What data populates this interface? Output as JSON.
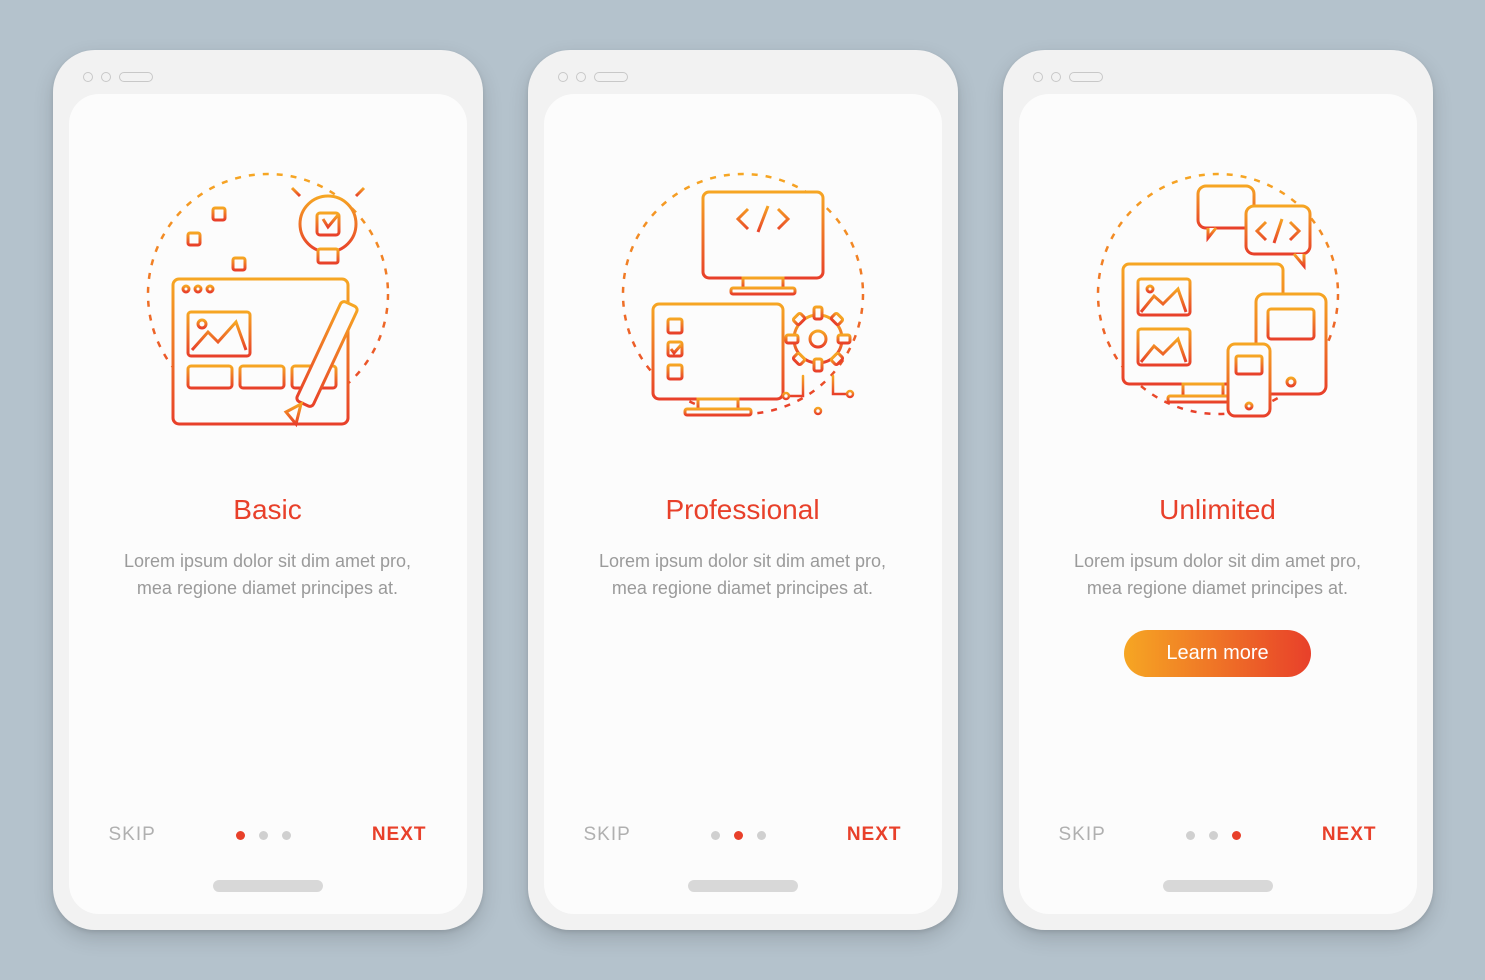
{
  "colors": {
    "accent_start": "#f6a623",
    "accent_end": "#e8402a",
    "bg": "#b4c2cc"
  },
  "screens": [
    {
      "title": "Basic",
      "description": "Lorem ipsum dolor sit dim amet pro, mea regione diamet principes at.",
      "illustration": "sliders-lightbulb-browser-pencil-icon",
      "skip_label": "SKIP",
      "next_label": "NEXT",
      "active_dot": 0,
      "has_cta": false
    },
    {
      "title": "Professional",
      "description": "Lorem ipsum dolor sit dim amet pro, mea regione diamet principes at.",
      "illustration": "code-monitor-checklist-gear-icon",
      "skip_label": "SKIP",
      "next_label": "NEXT",
      "active_dot": 1,
      "has_cta": false
    },
    {
      "title": "Unlimited",
      "description": "Lorem ipsum dolor sit dim amet pro, mea regione diamet principes at.",
      "illustration": "devices-chat-code-icon",
      "skip_label": "SKIP",
      "next_label": "NEXT",
      "cta_label": "Learn more",
      "active_dot": 2,
      "has_cta": true
    }
  ]
}
